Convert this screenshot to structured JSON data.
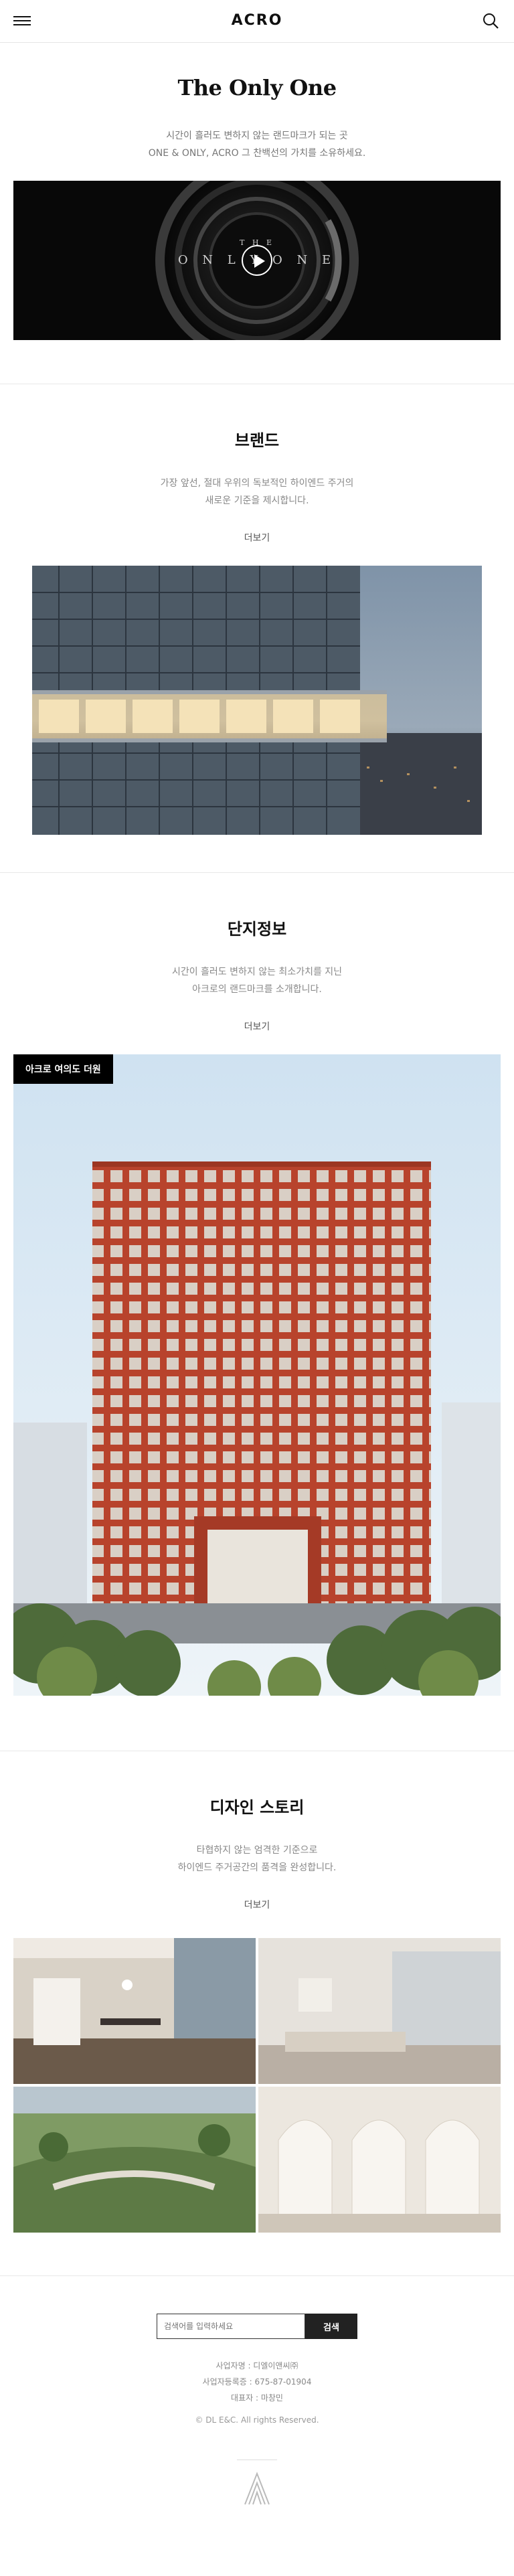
{
  "header": {
    "logo": "ACRO",
    "menu_icon": "hamburger-icon",
    "search_icon": "search-icon"
  },
  "intro": {
    "title": "The Only One",
    "desc_line1": "시간이 흘러도 변하지 않는 랜드마크가 되는 곳",
    "desc_line2": "ONE & ONLY, ACRO 그 찬백선의 가치를 소유하세요.",
    "video_text_top": "T H E",
    "video_text_main": "O N L Y   O N E",
    "play_icon": "play-icon"
  },
  "brand": {
    "title": "브랜드",
    "desc_line1": "가장 앞선, 절대 우위의 독보적인 하이엔드 주거의",
    "desc_line2": "새로운 기준을 제시합니다.",
    "more_label": "더보기"
  },
  "complex": {
    "title": "단지정보",
    "desc_line1": "시간이 흘러도 변하지 않는 최소가치를 지닌",
    "desc_line2": "아크로의 랜드마크를 소개합니다.",
    "more_label": "더보기",
    "tag": "아크로 여의도 더원"
  },
  "design": {
    "title": "디자인 스토리",
    "desc_line1": "타협하지 않는 엄격한 기준으로",
    "desc_line2": "하이엔드 주거공간의 품격을 완성합니다.",
    "more_label": "더보기"
  },
  "footer": {
    "search_placeholder": "검색어를 입력하세요",
    "search_button": "검색",
    "info_line1": "사업자명 : 디엘이앤씨㈜",
    "info_line2": "사업자등록증 : 675-87-01904",
    "info_line3": "대표자 : 마창민",
    "copyright": "© DL E&C. All rights Reserved.",
    "logo_icon": "acro-logo-icon"
  },
  "colors": {
    "text": "#111111",
    "muted": "#888888",
    "accent_dark": "#222222",
    "building_red": "#b8432c"
  }
}
